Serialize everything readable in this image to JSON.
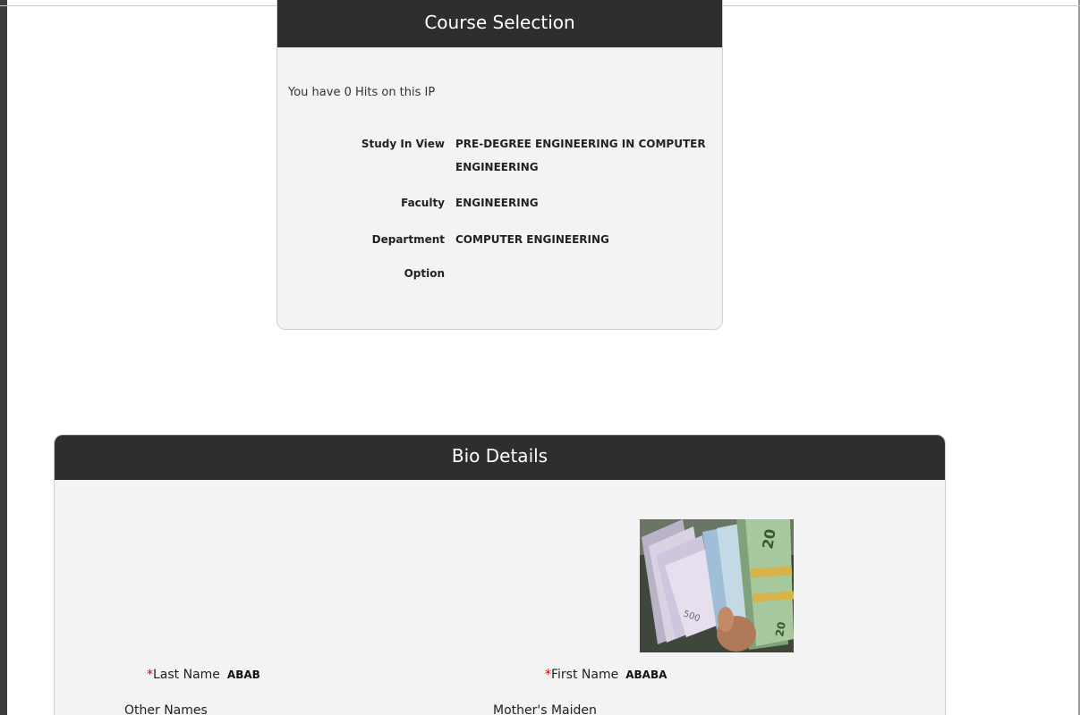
{
  "course_selection": {
    "title": "Course Selection",
    "hits_text": "You have 0 Hits on this IP",
    "rows": [
      {
        "label": "Study In View",
        "value": "PRE-DEGREE ENGINEERING IN COMPUTER ENGINEERING"
      },
      {
        "label": "Faculty",
        "value": "ENGINEERING"
      },
      {
        "label": "Department",
        "value": "COMPUTER ENGINEERING"
      },
      {
        "label": "Option",
        "value": ""
      }
    ]
  },
  "bio_details": {
    "title": "Bio Details",
    "photo_icon": "applicant-photo",
    "last_name": {
      "required_mark": "*",
      "label": "Last Name",
      "value": "ABAB"
    },
    "first_name": {
      "required_mark": "*",
      "label": "First Name",
      "value": "ABABA"
    },
    "other_names": {
      "label": "Other Names",
      "value": ""
    },
    "mothers_maiden": {
      "label": "Mother's Maiden",
      "value": ""
    }
  },
  "colors": {
    "header_bg": "#2e2e2e",
    "panel_bg": "#f3f3f3",
    "required": "#cc0000"
  }
}
